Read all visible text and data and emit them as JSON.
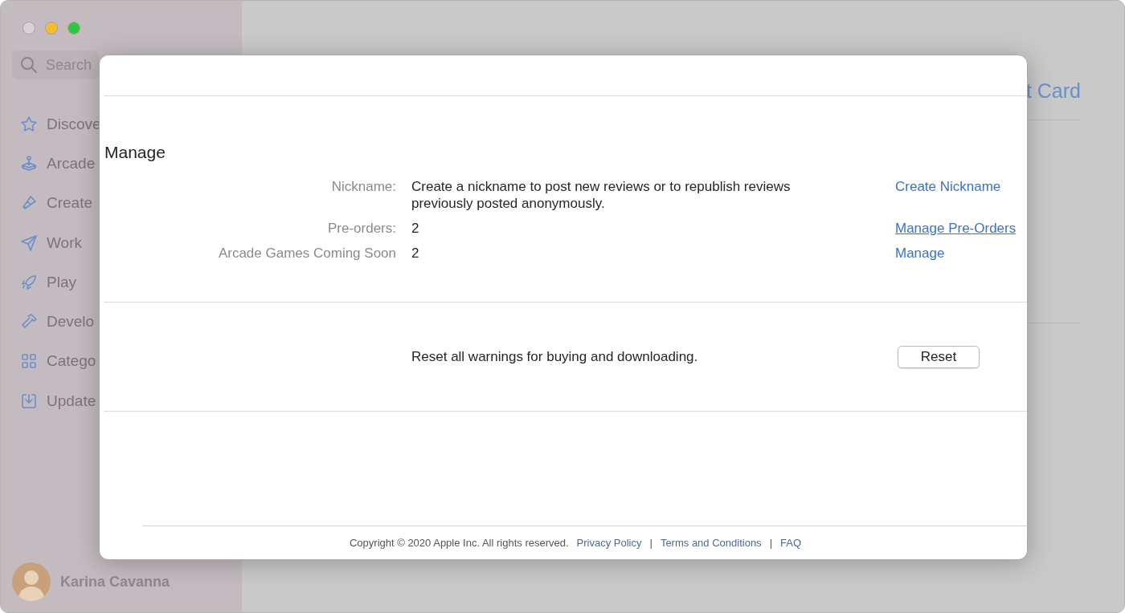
{
  "sidebar": {
    "search": {
      "placeholder": "Search"
    },
    "items": [
      {
        "label": "Discove"
      },
      {
        "label": "Arcade"
      },
      {
        "label": "Create"
      },
      {
        "label": "Work"
      },
      {
        "label": "Play"
      },
      {
        "label": "Develo"
      },
      {
        "label": "Catego"
      },
      {
        "label": "Update"
      }
    ],
    "user": {
      "name": "Karina Cavanna"
    }
  },
  "main": {
    "heading": "t Card"
  },
  "sheet": {
    "title": "Manage",
    "rows": [
      {
        "label": "Nickname:",
        "value": "Create a nickname to post new reviews or to republish reviews previously posted anonymously.",
        "action": "Create Nickname",
        "underlined": false
      },
      {
        "label": "Pre-orders:",
        "value": "2",
        "action": "Manage Pre-Orders",
        "underlined": true
      },
      {
        "label": "Arcade Games Coming Soon",
        "value": "2",
        "action": "Manage",
        "underlined": false
      }
    ],
    "reset": {
      "text": "Reset all warnings for buying and downloading.",
      "button": "Reset"
    },
    "footer": [
      {
        "kind": "text",
        "text": "Copyright © 2020 Apple Inc. All rights reserved."
      },
      {
        "kind": "link",
        "text": "Privacy Policy"
      },
      {
        "kind": "separator",
        "text": "|"
      },
      {
        "kind": "link",
        "text": "Terms and Conditions"
      },
      {
        "kind": "separator",
        "text": "|"
      },
      {
        "kind": "link",
        "text": "FAQ"
      }
    ]
  }
}
